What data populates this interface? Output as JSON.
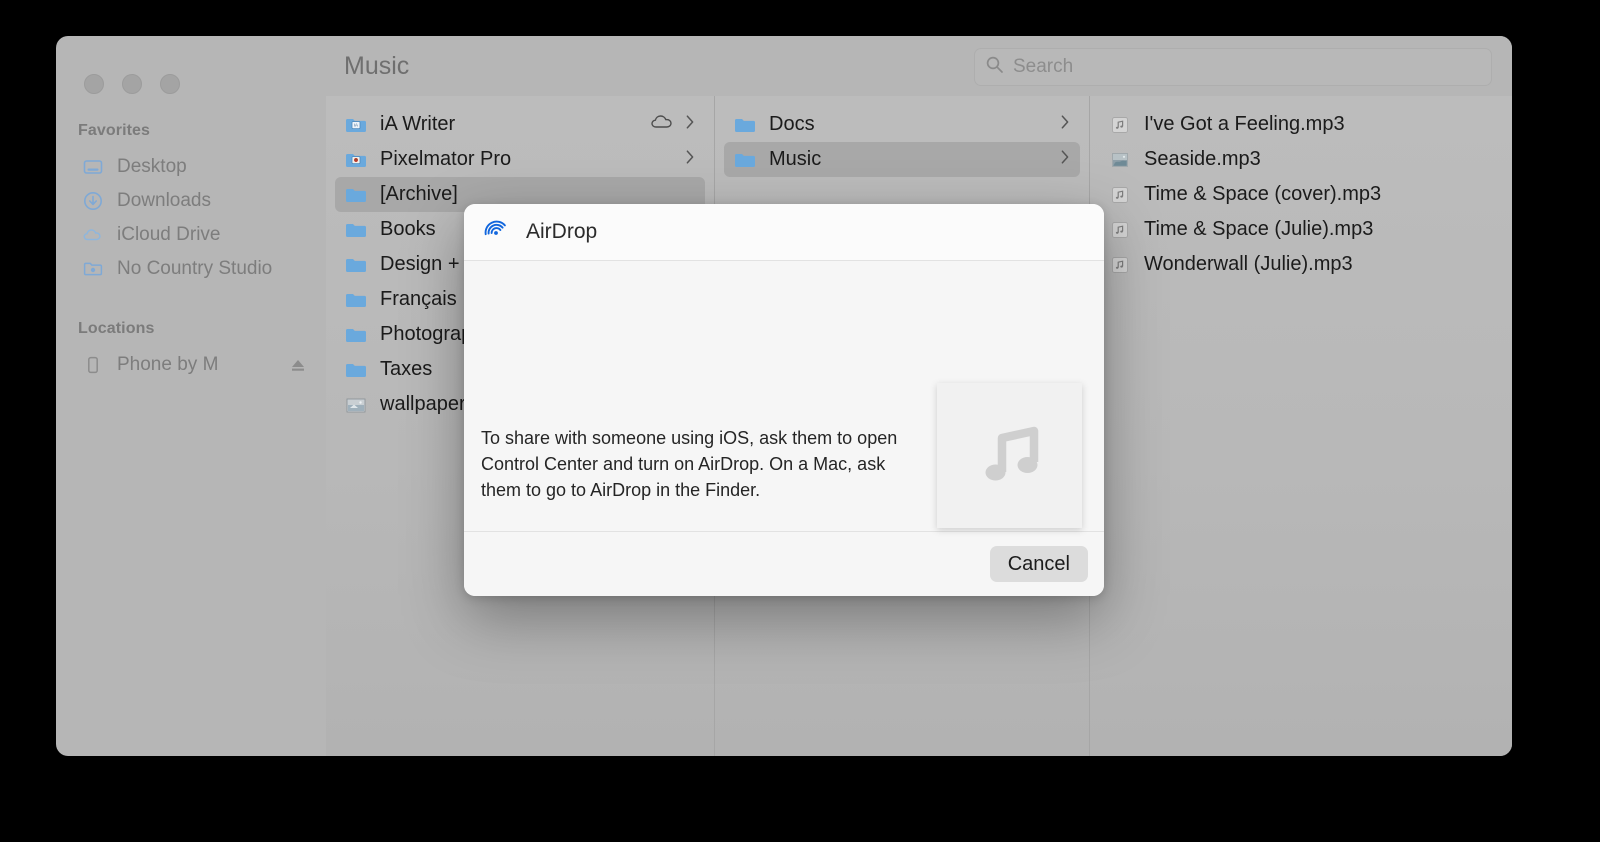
{
  "window": {
    "traffic_lights": [
      "close",
      "minimize",
      "maximize"
    ]
  },
  "toolbar": {
    "title": "Music",
    "search": {
      "placeholder": "Search",
      "value": "",
      "icon": "search-icon"
    }
  },
  "sidebar": {
    "sections": [
      {
        "header": "Favorites",
        "items": [
          {
            "label": "Desktop",
            "icon": "desktop-icon"
          },
          {
            "label": "Downloads",
            "icon": "downloads-arrow-icon"
          },
          {
            "label": "iCloud Drive",
            "icon": "cloud-icon"
          },
          {
            "label": "No Country Studio",
            "icon": "folder-badge-icon"
          }
        ]
      },
      {
        "header": "Locations",
        "items": [
          {
            "label": "Phone by M",
            "icon": "phone-icon",
            "eject": "eject-icon"
          }
        ]
      }
    ]
  },
  "columns": [
    {
      "name": "column-one",
      "items": [
        {
          "label": "iA Writer",
          "icon": "folder-app-icon",
          "cloud": true,
          "chevron": true,
          "selected": false
        },
        {
          "label": "Pixelmator Pro",
          "icon": "folder-app-icon",
          "cloud": false,
          "chevron": true,
          "selected": false
        },
        {
          "label": "[Archive]",
          "icon": "folder-icon",
          "cloud": false,
          "chevron": false,
          "selected": true
        },
        {
          "label": "Books",
          "icon": "folder-icon",
          "cloud": false,
          "chevron": false,
          "selected": false
        },
        {
          "label": "Design +",
          "icon": "folder-icon",
          "cloud": false,
          "chevron": false,
          "selected": false
        },
        {
          "label": "Français",
          "icon": "folder-icon",
          "cloud": false,
          "chevron": false,
          "selected": false
        },
        {
          "label": "Photography",
          "icon": "folder-icon",
          "cloud": false,
          "chevron": false,
          "selected": false
        },
        {
          "label": "Taxes",
          "icon": "folder-icon",
          "cloud": false,
          "chevron": false,
          "selected": false
        },
        {
          "label": "wallpapers",
          "icon": "image-thumb-icon",
          "cloud": false,
          "chevron": false,
          "selected": false
        }
      ]
    },
    {
      "name": "column-two",
      "items": [
        {
          "label": "Docs",
          "icon": "folder-icon",
          "chevron": true,
          "selected": false
        },
        {
          "label": "Music",
          "icon": "folder-icon",
          "chevron": true,
          "selected": true
        }
      ]
    },
    {
      "name": "column-three",
      "items": [
        {
          "label": "I've Got a Feeling.mp3",
          "icon": "music-file-icon",
          "selected": false
        },
        {
          "label": "Seaside.mp3",
          "icon": "image-thumb-icon",
          "selected": false
        },
        {
          "label": "Time & Space (cover).mp3",
          "icon": "music-file-icon",
          "selected": false
        },
        {
          "label": "Time & Space (Julie).mp3",
          "icon": "music-file-icon",
          "selected": false
        },
        {
          "label": "Wonderwall (Julie).mp3",
          "icon": "music-file-icon",
          "selected": false
        }
      ]
    }
  ],
  "dialog": {
    "title": "AirDrop",
    "icon": "airdrop-radar-icon",
    "message": "To share with someone using iOS, ask them to open Control Center and turn on AirDrop. On a Mac, ask them to go to AirDrop in the Finder.",
    "thumbnail_icon": "music-note-icon",
    "cancel_label": "Cancel"
  },
  "colors": {
    "airdrop_blue": "#1166dd",
    "folder_blue": "#6aa9dd",
    "sidebar_bg": "#b6b6b6",
    "dialog_bg": "#f6f6f6",
    "selection_gray": "#a8a8a8"
  }
}
